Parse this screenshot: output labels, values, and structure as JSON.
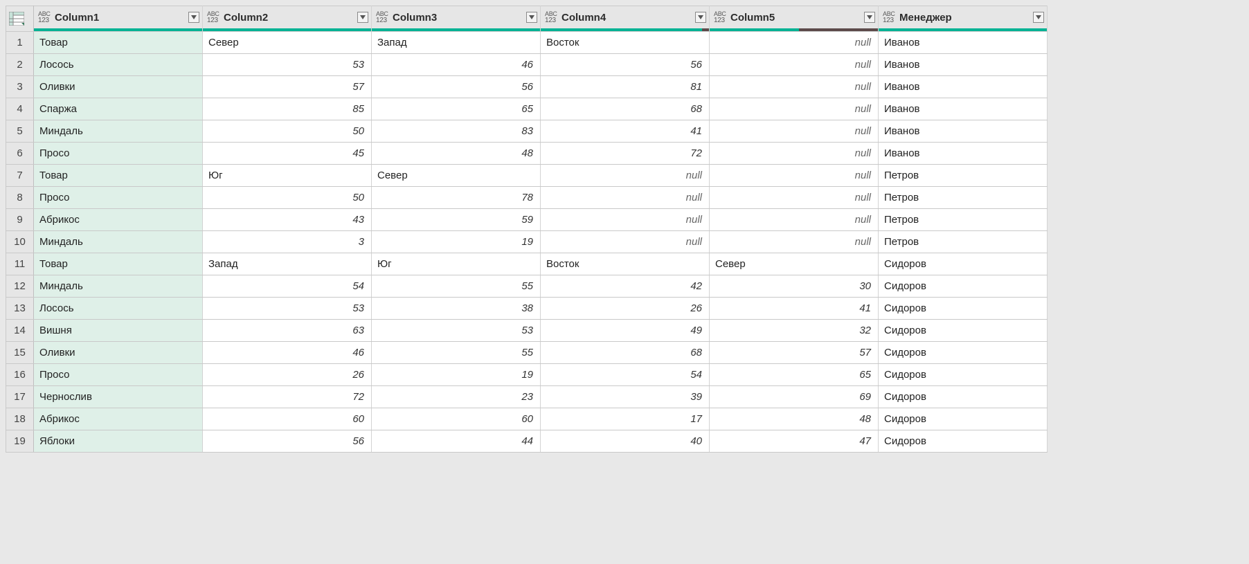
{
  "type_icon_top": "ABC",
  "type_icon_bottom": "123",
  "columns": [
    {
      "name": "Column1",
      "underlineDark": 0
    },
    {
      "name": "Column2",
      "underlineDark": 0
    },
    {
      "name": "Column3",
      "underlineDark": 0
    },
    {
      "name": "Column4",
      "underlineDark": 4
    },
    {
      "name": "Column5",
      "underlineDark": 47
    },
    {
      "name": "Менеджер",
      "underlineDark": 0
    }
  ],
  "null_label": "null",
  "rows": [
    {
      "n": "1",
      "c": [
        "Товар",
        "Север",
        "Запад",
        "Восток",
        null,
        "Иванов"
      ]
    },
    {
      "n": "2",
      "c": [
        "Лосось",
        "53",
        "46",
        "56",
        null,
        "Иванов"
      ]
    },
    {
      "n": "3",
      "c": [
        "Оливки",
        "57",
        "56",
        "81",
        null,
        "Иванов"
      ]
    },
    {
      "n": "4",
      "c": [
        "Спаржа",
        "85",
        "65",
        "68",
        null,
        "Иванов"
      ]
    },
    {
      "n": "5",
      "c": [
        "Миндаль",
        "50",
        "83",
        "41",
        null,
        "Иванов"
      ]
    },
    {
      "n": "6",
      "c": [
        "Просо",
        "45",
        "48",
        "72",
        null,
        "Иванов"
      ]
    },
    {
      "n": "7",
      "c": [
        "Товар",
        "Юг",
        "Север",
        null,
        null,
        "Петров"
      ]
    },
    {
      "n": "8",
      "c": [
        "Просо",
        "50",
        "78",
        null,
        null,
        "Петров"
      ]
    },
    {
      "n": "9",
      "c": [
        "Абрикос",
        "43",
        "59",
        null,
        null,
        "Петров"
      ]
    },
    {
      "n": "10",
      "c": [
        "Миндаль",
        "3",
        "19",
        null,
        null,
        "Петров"
      ]
    },
    {
      "n": "11",
      "c": [
        "Товар",
        "Запад",
        "Юг",
        "Восток",
        "Север",
        "Сидоров"
      ]
    },
    {
      "n": "12",
      "c": [
        "Миндаль",
        "54",
        "55",
        "42",
        "30",
        "Сидоров"
      ]
    },
    {
      "n": "13",
      "c": [
        "Лосось",
        "53",
        "38",
        "26",
        "41",
        "Сидоров"
      ]
    },
    {
      "n": "14",
      "c": [
        "Вишня",
        "63",
        "53",
        "49",
        "32",
        "Сидоров"
      ]
    },
    {
      "n": "15",
      "c": [
        "Оливки",
        "46",
        "55",
        "68",
        "57",
        "Сидоров"
      ]
    },
    {
      "n": "16",
      "c": [
        "Просо",
        "26",
        "19",
        "54",
        "65",
        "Сидоров"
      ]
    },
    {
      "n": "17",
      "c": [
        "Чернослив",
        "72",
        "23",
        "39",
        "69",
        "Сидоров"
      ]
    },
    {
      "n": "18",
      "c": [
        "Абрикос",
        "60",
        "60",
        "17",
        "48",
        "Сидоров"
      ]
    },
    {
      "n": "19",
      "c": [
        "Яблоки",
        "56",
        "44",
        "40",
        "47",
        "Сидоров"
      ]
    }
  ]
}
